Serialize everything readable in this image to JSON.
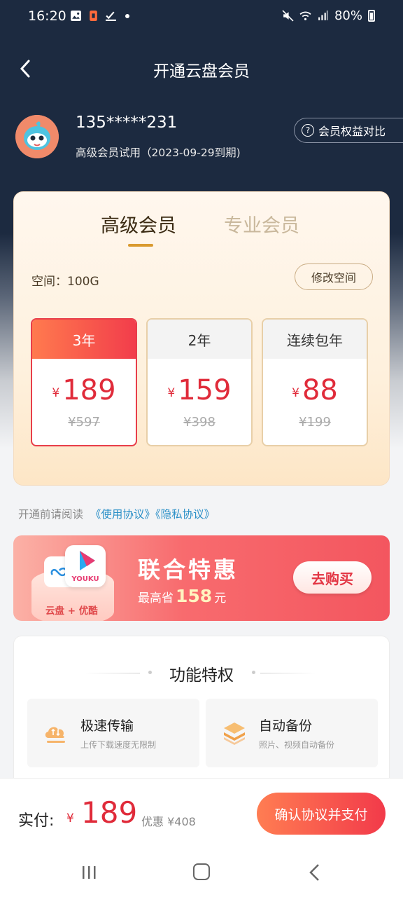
{
  "status_bar": {
    "time": "16:20",
    "battery": "80%"
  },
  "header": {
    "title": "开通云盘会员"
  },
  "user": {
    "phone": "135*****231",
    "membership": "高级会员试用（2023-09-29到期)",
    "compare_label": "会员权益对比"
  },
  "card": {
    "tabs": [
      {
        "label": "高级会员",
        "active": true
      },
      {
        "label": "专业会员",
        "active": false
      }
    ],
    "space_label": "空间：100G",
    "modify_label": "修改空间",
    "plans": [
      {
        "name": "3年",
        "currency": "¥",
        "price": "189",
        "original": "¥597",
        "selected": true
      },
      {
        "name": "2年",
        "currency": "¥",
        "price": "159",
        "original": "¥398",
        "selected": false
      },
      {
        "name": "连续包年",
        "currency": "¥",
        "price": "88",
        "original": "¥199",
        "selected": false
      }
    ]
  },
  "agreement": {
    "prefix": "开通前请阅读",
    "terms": "《使用协议》",
    "privacy": "《隐私协议》"
  },
  "promo": {
    "title": "联合特惠",
    "sub_prefix": "最高省",
    "sub_amount": "158",
    "sub_suffix": "元",
    "podium_text": "云盘 + 优酷",
    "youku_label": "YOUKU",
    "button": "去购买"
  },
  "features": {
    "title": "功能特权",
    "items": [
      {
        "name": "极速传输",
        "desc": "上传下载速度无限制",
        "icon": "cloud-transfer-icon"
      },
      {
        "name": "自动备份",
        "desc": "照片、视频自动备份",
        "icon": "layers-backup-icon"
      }
    ]
  },
  "pay": {
    "label": "实付:",
    "currency": "¥",
    "amount": "189",
    "discount": "优惠 ¥408",
    "button": "确认协议并支付"
  },
  "colors": {
    "accent_red": "#e02b3a",
    "header_bg": "#1c2a40",
    "gold": "#d99a2f",
    "link_blue": "#2a8fc7"
  }
}
